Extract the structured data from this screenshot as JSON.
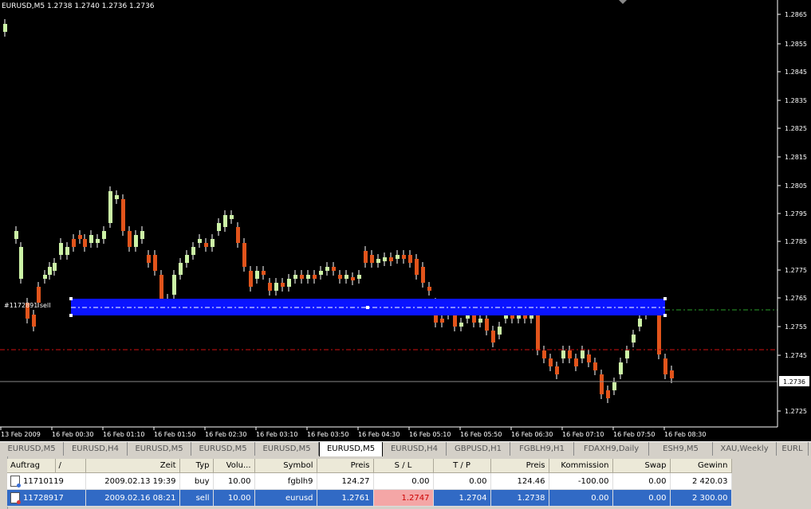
{
  "chart": {
    "symbol_label": "EURUSD,M5  1.2738 1.2740 1.2736 1.2736",
    "order_label": "#1172891  sell",
    "current_price_label": "1.2736",
    "price_labels": [
      "1.2865",
      "1.2855",
      "1.2845",
      "1.2835",
      "1.2825",
      "1.2815",
      "1.2805",
      "1.2795",
      "1.2785",
      "1.2775",
      "1.2765",
      "1.2755",
      "1.2745",
      "1.2725"
    ],
    "time_labels": [
      "13 Feb 2009",
      "16 Feb 00:30",
      "16 Feb 01:10",
      "16 Feb 01:50",
      "16 Feb 02:30",
      "16 Feb 03:10",
      "16 Feb 03:50",
      "16 Feb 04:30",
      "16 Feb 05:10",
      "16 Feb 05:50",
      "16 Feb 06:30",
      "16 Feb 07:10",
      "16 Feb 07:50",
      "16 Feb 08:30"
    ],
    "colors": {
      "bull": "#ccf2a6",
      "bear": "#e2541b",
      "wick": "#ffffff",
      "selection": "#0a14ff",
      "sl_line": "#d01010",
      "entry_line": "#2aa02a",
      "grid": "#ffffff"
    }
  },
  "tabs": [
    {
      "label": "EURUSD,M5",
      "active": false
    },
    {
      "label": "EURUSD,H4",
      "active": false
    },
    {
      "label": "EURUSD,M5",
      "active": false
    },
    {
      "label": "EURUSD,M5",
      "active": false
    },
    {
      "label": "EURUSD,M5",
      "active": false
    },
    {
      "label": "EURUSD,M5",
      "active": true
    },
    {
      "label": "EURUSD,H4",
      "active": false
    },
    {
      "label": "GBPUSD,H1",
      "active": false
    },
    {
      "label": "FGBLH9,H1",
      "active": false
    },
    {
      "label": "FDAXH9,Daily",
      "active": false
    },
    {
      "label": "ESH9,M5",
      "active": false
    },
    {
      "label": "XAU,Weekly",
      "active": false
    },
    {
      "label": "EURL",
      "active": false
    }
  ],
  "terminal": {
    "columns": [
      "Auftrag",
      "/",
      "Zeit",
      "Typ",
      "Volu...",
      "Symbol",
      "Preis",
      "S / L",
      "T / P",
      "Preis",
      "Kommission",
      "Swap",
      "Gewinn"
    ],
    "rows": [
      {
        "order": "11710119",
        "time": "2009.02.13 19:39",
        "type": "buy",
        "volume": "10.00",
        "symbol": "fgblh9",
        "price": "124.27",
        "sl": "0.00",
        "tp": "0.00",
        "cur_price": "124.46",
        "commission": "-100.00",
        "swap": "0.00",
        "profit": "2 420.03"
      },
      {
        "order": "11728917",
        "time": "2009.02.16 08:21",
        "type": "sell",
        "volume": "10.00",
        "symbol": "eurusd",
        "price": "1.2761",
        "sl": "1.2747",
        "tp": "1.2704",
        "cur_price": "1.2738",
        "commission": "0.00",
        "swap": "0.00",
        "profit": "2 300.00"
      }
    ]
  }
}
